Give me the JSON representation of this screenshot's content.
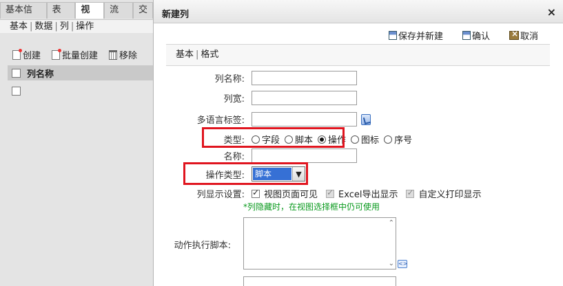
{
  "left_panel": {
    "tabs": [
      "基本信息",
      "表单",
      "视图",
      "流程",
      "交"
    ],
    "active_tab": 2,
    "subtabs": [
      "基本",
      "数据",
      "列",
      "操作"
    ],
    "toolbar": {
      "create": "创建",
      "batch_create": "批量创建",
      "remove": "移除"
    },
    "table_header": "列名称"
  },
  "dialog": {
    "title": "新建列",
    "close": "×",
    "toolbar": {
      "save_new": "保存并新建",
      "confirm": "确认",
      "cancel": "取消"
    },
    "form_tabs": {
      "basic": "基本",
      "format": "格式"
    },
    "labels": {
      "col_name": "列名称:",
      "col_width": "列宽:",
      "multilang": "多语言标签:",
      "type": "类型:",
      "name": "名称:",
      "op_type": "操作类型:",
      "display": "列显示设置:",
      "script": "动作执行脚本:"
    },
    "type_options": [
      "字段",
      "脚本",
      "操作",
      "图标",
      "序号"
    ],
    "type_selected": "操作",
    "op_type_value": "脚本",
    "display_options": [
      {
        "label": "视图页面可见",
        "checked": true,
        "disabled": false
      },
      {
        "label": "Excel导出显示",
        "checked": true,
        "disabled": true
      },
      {
        "label": "自定义打印显示",
        "checked": true,
        "disabled": true
      }
    ],
    "hint": "*列隐藏时，在视图选择框中仍可使用"
  },
  "colors": {
    "highlight_border": "#e0141e",
    "select_bg": "#3670d5",
    "hint_text": "#0a9a1e"
  }
}
